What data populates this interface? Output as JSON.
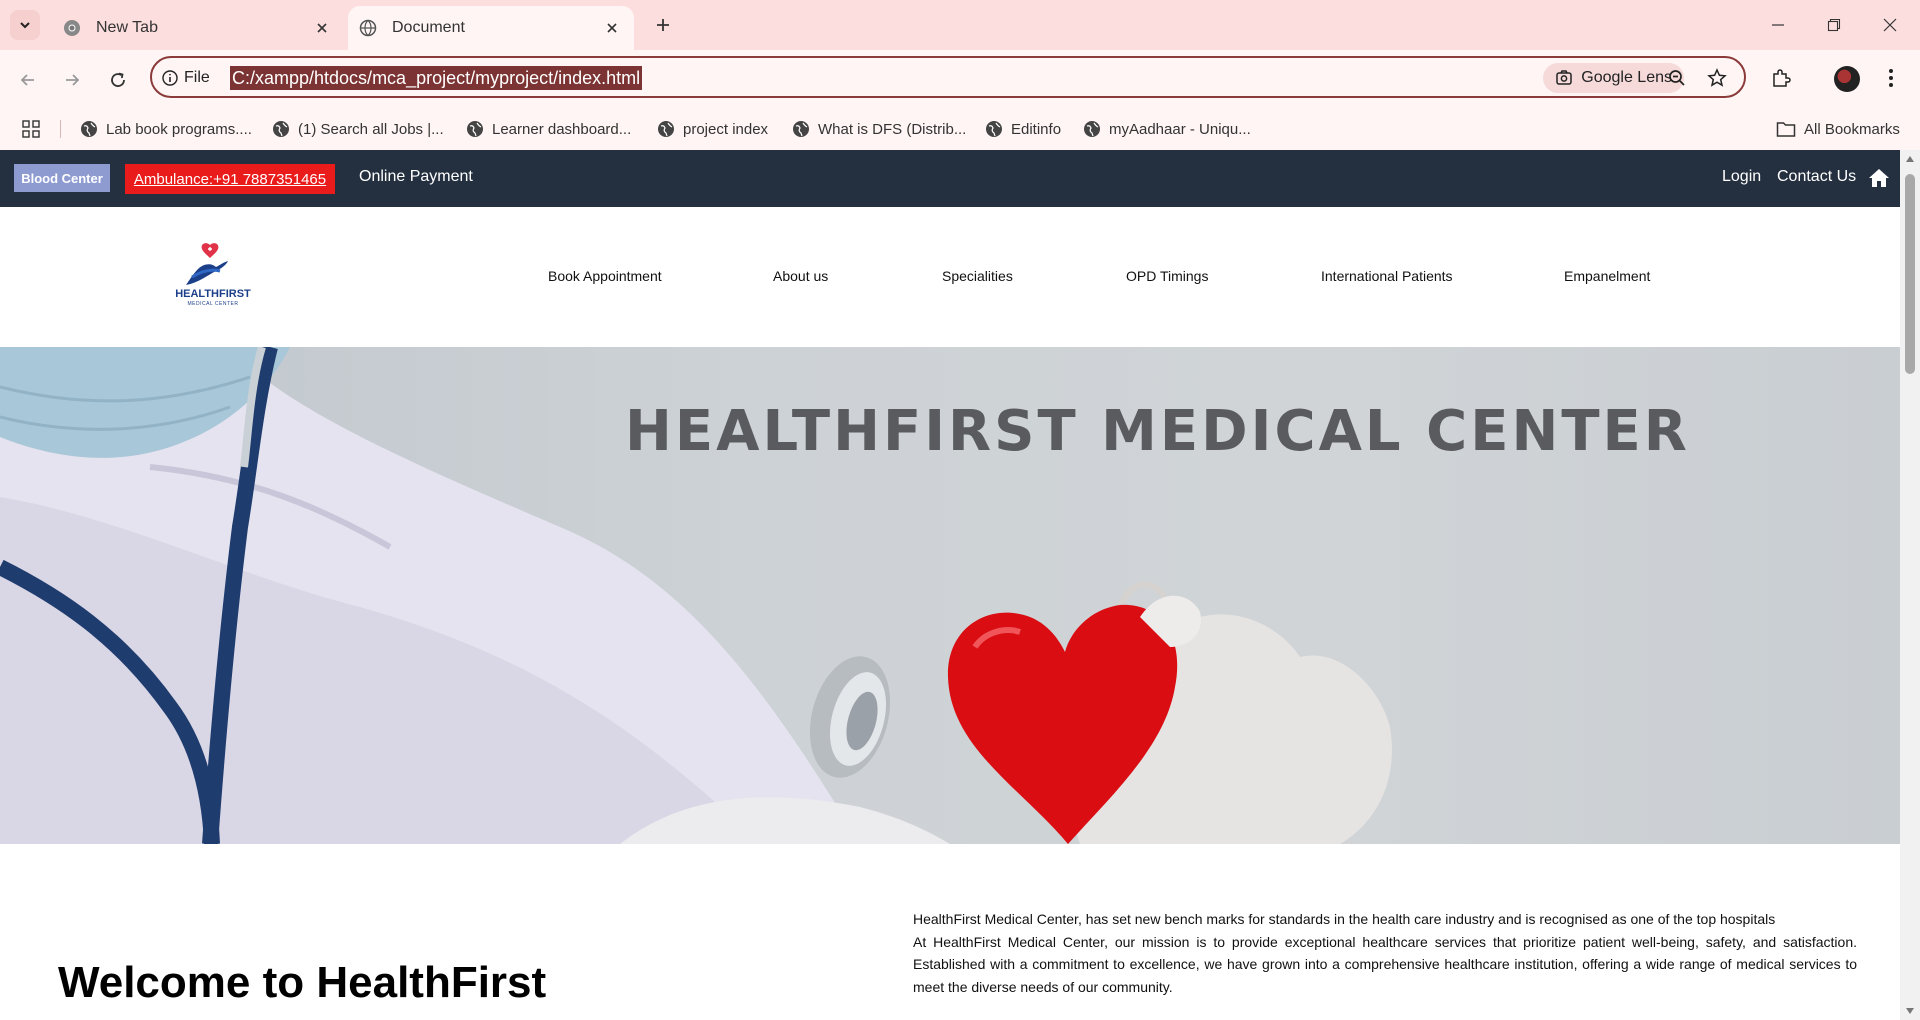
{
  "browser": {
    "tabs": [
      {
        "title": "New Tab",
        "active": false
      },
      {
        "title": "Document",
        "active": true
      }
    ],
    "address": {
      "scheme_label": "File",
      "url": "C:/xampp/htdocs/mca_project/myproject/index.html"
    },
    "lens_label": "Google Lens",
    "bookmarks": [
      "Lab book programs....",
      "(1) Search all Jobs |...",
      "Learner dashboard...",
      "project index",
      "What is DFS (Distrib...",
      "Editinfo",
      "myAadhaar - Uniqu..."
    ],
    "all_bookmarks_label": "All Bookmarks"
  },
  "site": {
    "topbar": {
      "blood_center": "Blood Center",
      "ambulance": "Ambulance:+91 7887351465",
      "online_payment": "Online Payment",
      "login": "Login",
      "contact": "Contact Us"
    },
    "logo": {
      "name": "HEALTHFIRST",
      "sub": "MEDICAL CENTER"
    },
    "nav": [
      "Book Appointment",
      "About us",
      "Specialities",
      "OPD Timings",
      "International Patients",
      "Empanelment"
    ],
    "hero_title": "HEALTHFIRST MEDICAL CENTER",
    "welcome_heading": "Welcome to HealthFirst",
    "intro": [
      "HealthFirst Medical Center, has set new bench marks for standards in the health care industry and is recognised as one of the top hospitals",
      "At HealthFirst Medical Center, our mission is to provide exceptional healthcare services that prioritize patient well-being, safety, and satisfaction. Established with a commitment to excellence, we have grown into a comprehensive healthcare institution, offering a wide range of medical services to meet the diverse needs of our community."
    ]
  },
  "colors": {
    "tabstrip": "#fcdede",
    "topbar": "#24303f",
    "ambulance_red": "#ea1b1b",
    "blood_center": "#8e9bd0",
    "heart_red": "#d90d12"
  }
}
